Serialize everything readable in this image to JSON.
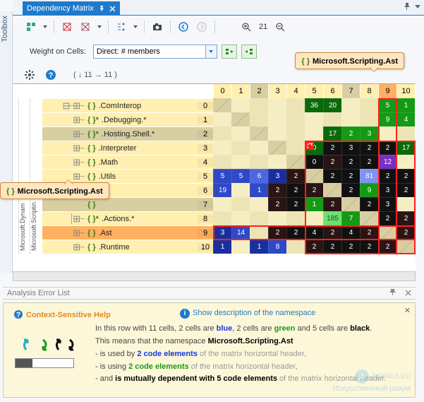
{
  "toolbox_label": "Toolbox",
  "tab_title": "Dependency Matrix",
  "zoom_value": "21",
  "weight_label": "Weight on Cells:",
  "weight_value": "Direct: # members",
  "callout_top": "Microsoft.Scripting.Ast",
  "callout_left": "Microsoft.Scripting.Ast",
  "arrows_text": "( ↓ 11  → 11 )",
  "tree_cols": [
    "Microsoft.Dynam",
    "Microsoft.Scriptin"
  ],
  "col_indices": [
    "0",
    "1",
    "2",
    "3",
    "4",
    "5",
    "6",
    "7",
    "8",
    "9",
    "10"
  ],
  "rows": [
    {
      "tree": "⊟┈⊞┈",
      "name": ".ComInterop",
      "idx": "0",
      "hi": false
    },
    {
      "tree": "⊞┈",
      "star": true,
      "name": ".Debugging.*",
      "idx": "1",
      "hi": false
    },
    {
      "tree": "⊞┈",
      "star": true,
      "name": ".Hosting.Shell.*",
      "idx": "2",
      "hi": false,
      "rule": true
    },
    {
      "tree": "⊞┈",
      "name": ".Interpreter",
      "idx": "3",
      "hi": false
    },
    {
      "tree": "⊞┈",
      "name": ".Math",
      "idx": "4",
      "hi": false
    },
    {
      "tree": "⊞┈",
      "name": ".Utils",
      "idx": "5",
      "hi": false
    },
    {
      "tree": "",
      "name": "",
      "idx": "6",
      "hi": false
    },
    {
      "tree": "",
      "name": "",
      "idx": "7",
      "hi": false,
      "rule": true
    },
    {
      "tree": "┊⊞┈",
      "star": true,
      "name": ".Actions.*",
      "idx": "8",
      "hi": false
    },
    {
      "tree": "⊞┈",
      "name": ".Ast",
      "idx": "9",
      "hi": true
    },
    {
      "tree": "⊞┈",
      "name": ".Runtime",
      "idx": "10",
      "hi": false
    }
  ],
  "palette": {
    "diag": "#c9c0a0",
    "cream": "#f5eec2",
    "cream2": "#ece4b4",
    "blue4": "#1a2f9e",
    "blue3": "#2f49c6",
    "blue2": "#4d66e2",
    "blue1": "#8092f2",
    "green4": "#0a6a0a",
    "green3": "#149a14",
    "green2": "#2fbf2f",
    "green1": "#6fe06f",
    "black": "#111",
    "dk": "#2a1414",
    "purple": "#7a2fbf",
    "bggrey": "#6c6c6c"
  },
  "grid": [
    [
      [
        "diag",
        ""
      ],
      [
        "cream",
        ""
      ],
      [
        "cream2",
        ""
      ],
      [
        "cream",
        ""
      ],
      [
        "cream2",
        ""
      ],
      [
        "green4",
        "36"
      ],
      [
        "green4",
        "20"
      ],
      [
        "cream",
        ""
      ],
      [
        "cream2",
        ""
      ],
      [
        "green3",
        "5"
      ],
      [
        "green3",
        "1"
      ]
    ],
    [
      [
        "cream",
        ""
      ],
      [
        "diag",
        ""
      ],
      [
        "cream2",
        ""
      ],
      [
        "cream",
        ""
      ],
      [
        "cream2",
        ""
      ],
      [
        "cream",
        ""
      ],
      [
        "cream2",
        ""
      ],
      [
        "cream",
        ""
      ],
      [
        "cream2",
        ""
      ],
      [
        "green3",
        "9"
      ],
      [
        "green3",
        "4"
      ]
    ],
    [
      [
        "cream2",
        ""
      ],
      [
        "cream",
        ""
      ],
      [
        "diag",
        ""
      ],
      [
        "cream",
        ""
      ],
      [
        "cream2",
        ""
      ],
      [
        "cream",
        ""
      ],
      [
        "green4",
        "17"
      ],
      [
        "green3",
        "2"
      ],
      [
        "green3",
        "3"
      ],
      [
        "cream",
        ""
      ],
      [
        "cream2",
        ""
      ]
    ],
    [
      [
        "cream",
        ""
      ],
      [
        "cream2",
        ""
      ],
      [
        "cream",
        ""
      ],
      [
        "diag",
        ""
      ],
      [
        "cream2",
        ""
      ],
      [
        "green4",
        "0"
      ],
      [
        "black",
        "2"
      ],
      [
        "black",
        "3"
      ],
      [
        "black",
        "2"
      ],
      [
        "black",
        "2"
      ],
      [
        "green4",
        "17"
      ]
    ],
    [
      [
        "cream2",
        ""
      ],
      [
        "cream",
        ""
      ],
      [
        "cream2",
        ""
      ],
      [
        "cream",
        ""
      ],
      [
        "diag",
        ""
      ],
      [
        "black",
        "0"
      ],
      [
        "dk",
        "2"
      ],
      [
        "black",
        "2"
      ],
      [
        "black",
        "2"
      ],
      [
        "purple",
        "12"
      ],
      [
        "cream",
        ""
      ]
    ],
    [
      [
        "blue3",
        "5"
      ],
      [
        "blue3",
        "5"
      ],
      [
        "blue2",
        "6"
      ],
      [
        "blue4",
        "3"
      ],
      [
        "dk",
        "2"
      ],
      [
        "diag",
        ""
      ],
      [
        "black",
        "2"
      ],
      [
        "black",
        "2"
      ],
      [
        "blue1",
        "81"
      ],
      [
        "black",
        "2"
      ],
      [
        "black",
        "2"
      ]
    ],
    [
      [
        "blue3",
        "19"
      ],
      [
        "cream",
        ""
      ],
      [
        "blue3",
        "1"
      ],
      [
        "dk",
        "2"
      ],
      [
        "black",
        "2"
      ],
      [
        "dk",
        "2"
      ],
      [
        "diag",
        ""
      ],
      [
        "black",
        "2"
      ],
      [
        "green3",
        "9"
      ],
      [
        "black",
        "3"
      ],
      [
        "black",
        "2"
      ]
    ],
    [
      [
        "cream",
        ""
      ],
      [
        "cream2",
        ""
      ],
      [
        "cream",
        ""
      ],
      [
        "dk",
        "2"
      ],
      [
        "black",
        "2"
      ],
      [
        "green3",
        "1"
      ],
      [
        "dk",
        "2"
      ],
      [
        "diag",
        ""
      ],
      [
        "black",
        "2"
      ],
      [
        "black",
        "3"
      ],
      [
        "cream",
        ""
      ]
    ],
    [
      [
        "cream2",
        ""
      ],
      [
        "cream",
        ""
      ],
      [
        "cream2",
        ""
      ],
      [
        "cream",
        ""
      ],
      [
        "cream2",
        ""
      ],
      [
        "cream",
        ""
      ],
      [
        "green1",
        "185"
      ],
      [
        "green3",
        "7"
      ],
      [
        "diag",
        ""
      ],
      [
        "black",
        "2"
      ],
      [
        "dk",
        "2"
      ]
    ],
    [
      [
        "blue4",
        "3"
      ],
      [
        "blue3",
        "14"
      ],
      [
        "cream2",
        ""
      ],
      [
        "dk",
        "2"
      ],
      [
        "black",
        "2"
      ],
      [
        "black",
        "4"
      ],
      [
        "dk",
        "2"
      ],
      [
        "black",
        "4"
      ],
      [
        "dk",
        "2"
      ],
      [
        "diag",
        ""
      ],
      [
        "dk",
        "2"
      ]
    ],
    [
      [
        "blue4",
        "1"
      ],
      [
        "cream",
        ""
      ],
      [
        "blue4",
        "1"
      ],
      [
        "blue3",
        "8"
      ],
      [
        "cream2",
        ""
      ],
      [
        "dk",
        "2"
      ],
      [
        "black",
        "2"
      ],
      [
        "black",
        "2"
      ],
      [
        "black",
        "2"
      ],
      [
        "dk",
        "2"
      ],
      [
        "diag",
        ""
      ]
    ]
  ],
  "error_label": "Analysis Error List",
  "help": {
    "title": "Context-Sensitive Help",
    "link": "Show description of the namespace",
    "p1_a": "In this row with 11 cells, 2 cells are ",
    "p1_blue": "blue",
    "p1_b": ", 2 cells are ",
    "p1_green": "green",
    "p1_c": " and 5 cells are ",
    "p1_black": "black",
    "p1_d": ".",
    "p2_a": "This means that the namespace ",
    "p2_ns": "Microsoft.Scripting.Ast",
    "p3_a": "- is used by ",
    "p3_b": "2 code elements",
    "p3_c": " of the matrix horizontal header,",
    "p4_a": "- is using ",
    "p4_b": "2 code elements",
    "p4_c": " of the matrix horizontal header,",
    "p5_a": "- and ",
    "p5_b": "is mutually dependent with 5 code elements",
    "p5_c": " of the matrix horizontal header."
  },
  "watermark_a": "Intellect.icu",
  "watermark_b": "Искусственный разум"
}
